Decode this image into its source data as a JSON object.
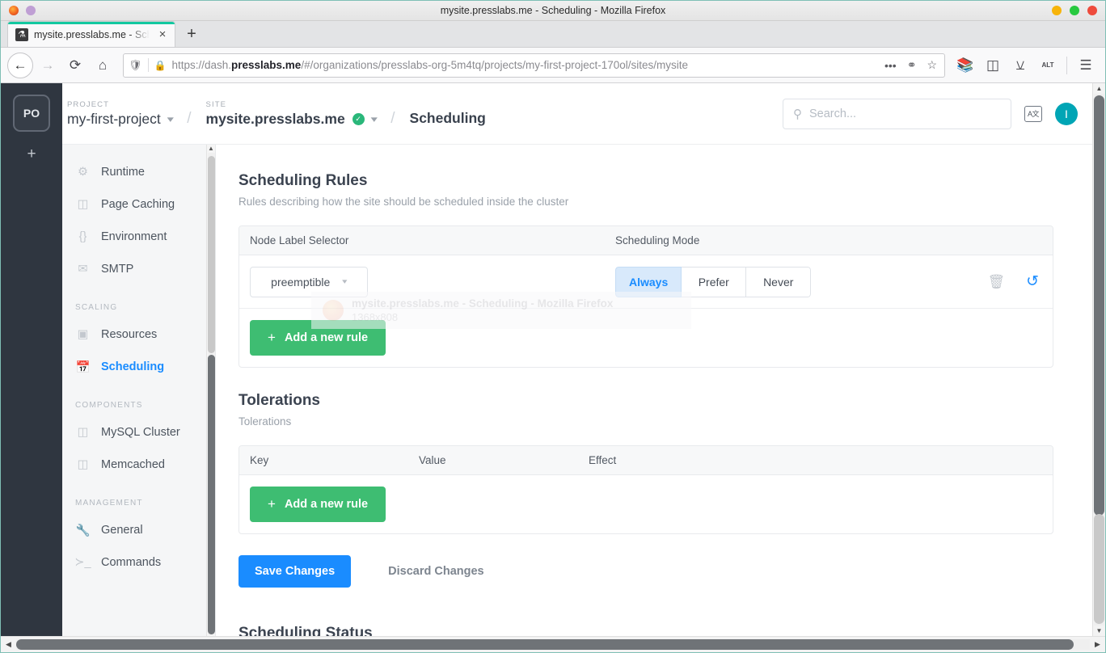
{
  "window": {
    "title": "mysite.presslabs.me - Scheduling - Mozilla Firefox",
    "controls": {
      "minimize": "minimize",
      "maximize": "maximize",
      "close": "close"
    }
  },
  "browser": {
    "tab": {
      "label": "mysite.presslabs.me - Sch",
      "favicon": "flask-icon",
      "close": "×"
    },
    "new_tab": "+",
    "nav": {
      "back": "←",
      "forward": "→",
      "reload": "⟳",
      "home": "⌂"
    },
    "url": {
      "prefix": "https://dash.",
      "bold": "presslabs.me",
      "suffix": "/#/organizations/presslabs-org-5m4tq/projects/my-first-project-170ol/sites/mysite",
      "shield": "shield-icon",
      "lock": "🔒",
      "page_actions": "•••",
      "pocket": "pocket-icon",
      "bookmark": "☆"
    },
    "toolbar": {
      "library": "library-icon",
      "sidebar": "sidebar-icon",
      "account": "account-icon",
      "extension": "ALT",
      "menu": "☰"
    }
  },
  "rail": {
    "org_initials": "PO",
    "add": "+"
  },
  "header": {
    "project": {
      "kicker": "PROJECT",
      "name": "my-first-project"
    },
    "site": {
      "kicker": "SITE",
      "name": "mysite.presslabs.me",
      "verified": "✓"
    },
    "separator": "/",
    "page_title": "Scheduling",
    "search": {
      "placeholder": "Search...",
      "value": "",
      "icon": "search-icon"
    },
    "language_button": "A文",
    "avatar": "I"
  },
  "sidebar": {
    "items": [
      {
        "label": "Runtime",
        "icon": "gear-icon",
        "active": false
      },
      {
        "label": "Page Caching",
        "icon": "database-bolt-icon",
        "active": false
      },
      {
        "label": "Environment",
        "icon": "braces-icon",
        "active": false
      },
      {
        "label": "SMTP",
        "icon": "envelope-icon",
        "active": false
      }
    ],
    "groups": [
      {
        "label": "SCALING",
        "items": [
          {
            "label": "Resources",
            "icon": "cpu-icon",
            "active": false
          },
          {
            "label": "Scheduling",
            "icon": "calendar-arrow-icon",
            "active": true
          }
        ]
      },
      {
        "label": "COMPONENTS",
        "items": [
          {
            "label": "MySQL Cluster",
            "icon": "database-icon",
            "active": false
          },
          {
            "label": "Memcached",
            "icon": "database-bolt-icon",
            "active": false
          }
        ]
      },
      {
        "label": "MANAGEMENT",
        "items": [
          {
            "label": "General",
            "icon": "wrench-icon",
            "active": false
          },
          {
            "label": "Commands",
            "icon": "terminal-icon",
            "active": false
          }
        ]
      }
    ]
  },
  "main": {
    "scheduling_rules": {
      "title": "Scheduling Rules",
      "subtitle": "Rules describing how the site should be scheduled inside the cluster",
      "columns": [
        "Node Label Selector",
        "Scheduling Mode"
      ],
      "rows": [
        {
          "selector_value": "preemptible",
          "modes": [
            "Always",
            "Prefer",
            "Never"
          ],
          "selected_mode": "Always",
          "delete_icon": "trash-icon",
          "reset_icon": "reset-icon"
        }
      ],
      "add_button": {
        "label": "Add a new rule",
        "plus": "+"
      }
    },
    "tolerations": {
      "title": "Tolerations",
      "subtitle": "Tolerations",
      "columns": [
        "Key",
        "Value",
        "Effect"
      ],
      "rows": [],
      "add_button": {
        "label": "Add a new rule",
        "plus": "+"
      }
    },
    "actions": {
      "save": "Save Changes",
      "discard": "Discard Changes"
    },
    "bottom_section_title": "Scheduling Status"
  },
  "overlay_ghost": {
    "title": "mysite.presslabs.me - Scheduling - Mozilla Firefox",
    "dimensions": "1368x808"
  },
  "colors": {
    "accent_blue": "#1a8cff",
    "green": "#3ebd72",
    "teal_avatar": "#00a5b5",
    "rail_dark": "#2f3640",
    "verified_green": "#2ab77a",
    "tab_highlight": "#12c8a0"
  }
}
